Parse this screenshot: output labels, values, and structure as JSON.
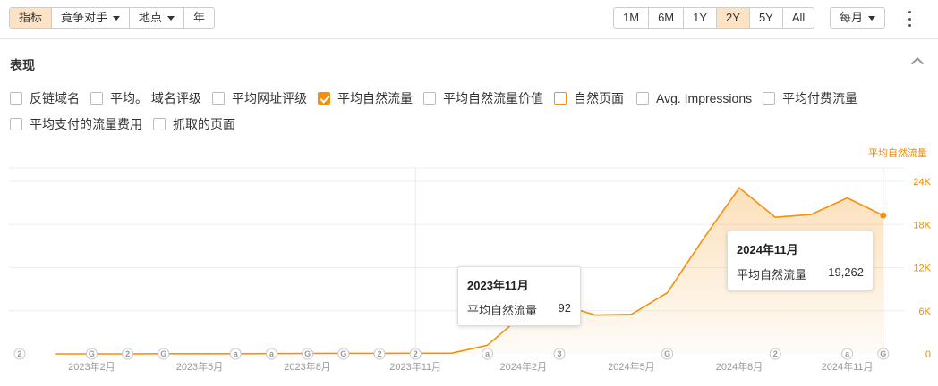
{
  "toolbar": {
    "left_buttons": [
      {
        "label": "指标",
        "active": true
      },
      {
        "label": "竟争对手",
        "dropdown": true
      },
      {
        "label": "地点",
        "dropdown": true
      },
      {
        "label": "年"
      }
    ],
    "ranges": [
      "1M",
      "6M",
      "1Y",
      "2Y",
      "5Y",
      "All"
    ],
    "active_range": "2Y",
    "interval": "每月"
  },
  "section": {
    "title": "表现"
  },
  "metrics_row1": [
    {
      "label": "反链域名",
      "checked": false
    },
    {
      "label": "平均。 域名评级",
      "checked": false
    },
    {
      "label": "平均网址评级",
      "checked": false
    },
    {
      "label": "平均自然流量",
      "checked": true
    },
    {
      "label": "平均自然流量价值",
      "checked": false
    },
    {
      "label": "自然页面",
      "checked": false,
      "accent": true
    },
    {
      "label": "Avg. Impressions",
      "checked": false
    },
    {
      "label": "平均付费流量",
      "checked": false
    }
  ],
  "metrics_row2": [
    {
      "label": "平均支付的流量费用",
      "checked": false
    },
    {
      "label": "抓取的页面",
      "checked": false
    }
  ],
  "colors": {
    "accent": "#f5900a",
    "active_bg": "#fde3c4"
  },
  "chart_data": {
    "type": "area",
    "y_axis_title": "平均自然流量",
    "ylim": [
      0,
      24000
    ],
    "y_ticks": [
      {
        "value": 0,
        "label": "0"
      },
      {
        "value": 6000,
        "label": "6K"
      },
      {
        "value": 12000,
        "label": "12K"
      },
      {
        "value": 18000,
        "label": "18K"
      },
      {
        "value": 24000,
        "label": "24K"
      }
    ],
    "x_labels": [
      {
        "index": 2,
        "label": "2023年2月"
      },
      {
        "index": 5,
        "label": "2023年5月"
      },
      {
        "index": 8,
        "label": "2023年8月"
      },
      {
        "index": 11,
        "label": "2023年11月"
      },
      {
        "index": 14,
        "label": "2024年2月"
      },
      {
        "index": 17,
        "label": "2024年5月"
      },
      {
        "index": 20,
        "label": "2024年8月"
      },
      {
        "index": 23,
        "label": "2024年11月"
      }
    ],
    "series": [
      {
        "values": [
          0,
          0,
          0,
          20,
          20,
          30,
          40,
          60,
          70,
          80,
          90,
          92,
          1200,
          5500,
          6900,
          5400,
          5500,
          8500,
          16000,
          23100,
          19000,
          19400,
          21700,
          19262
        ]
      }
    ],
    "markers": [
      {
        "index": 0,
        "symbol": "2"
      },
      {
        "index": 2,
        "symbol": "G"
      },
      {
        "index": 3,
        "symbol": "2"
      },
      {
        "index": 4,
        "symbol": "G"
      },
      {
        "index": 6,
        "symbol": "a"
      },
      {
        "index": 7,
        "symbol": "a"
      },
      {
        "index": 8,
        "symbol": "G"
      },
      {
        "index": 9,
        "symbol": "G"
      },
      {
        "index": 10,
        "symbol": "2"
      },
      {
        "index": 11,
        "symbol": "2"
      },
      {
        "index": 13,
        "symbol": "a"
      },
      {
        "index": 15,
        "symbol": "3"
      },
      {
        "index": 18,
        "symbol": "G"
      },
      {
        "index": 21,
        "symbol": "2"
      },
      {
        "index": 23,
        "symbol": "a"
      },
      {
        "index": 24,
        "symbol": "G"
      }
    ],
    "grid": true,
    "legend": "none"
  },
  "tooltips": [
    {
      "date": "2023年11月",
      "metric": "平均自然流量",
      "value": "92"
    },
    {
      "date": "2024年11月",
      "metric": "平均自然流量",
      "value": "19,262"
    }
  ]
}
